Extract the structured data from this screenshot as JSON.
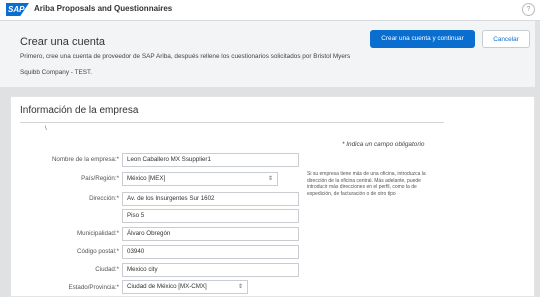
{
  "topbar": {
    "logo_text": "SAP",
    "app_title": "Ariba Proposals and Questionnaires",
    "chevron_glyph": "⌄",
    "help_glyph": "?"
  },
  "header": {
    "title": "Crear una cuenta",
    "primary_button": "Crear una cuenta y continuar",
    "cancel_button": "Cancelar",
    "intro_line1": "Primero, cree una cuenta de proveedor de SAP Ariba, después rellene los cuestionarios solicitados por Bristol Myers",
    "intro_line2": "Squibb Company - TEST."
  },
  "section": {
    "title": "Información de la empresa",
    "tick": "\\",
    "required_note": "*  Indica un campo obligatorio",
    "help_text": "Si su empresa tiene más de una oficina, introduzca la dirección de la oficina central. Más adelante, puede introducir más direcciones en el perfil, como la de expedición, de facturación o de otro tipo"
  },
  "form": {
    "company_name": {
      "label": "Nombre de la empresa:*",
      "value": "Leon Caballero MX Ssupplier1"
    },
    "country": {
      "label": "País/Región:*",
      "value": "México  [MEX]"
    },
    "address": {
      "label": "Dirección:*",
      "line1": "Av. de los Insurgentes Sur 1602",
      "line2": "Piso 5"
    },
    "municipality": {
      "label": "Municipalidad:*",
      "value": "Álvaro Obregón"
    },
    "postal_code": {
      "label": "Código postal:*",
      "value": "03940"
    },
    "city": {
      "label": "Ciudad:*",
      "value": "Mexico city"
    },
    "state": {
      "label": "Estado/Provincia:*",
      "value": "Ciudad de México  [MX-CMX]"
    }
  },
  "colors": {
    "accent": "#0a6ed1",
    "page_bg": "#dfe1e3",
    "header_bg": "#f3f4f5"
  },
  "icons": {
    "select_arrow": "⇕"
  }
}
